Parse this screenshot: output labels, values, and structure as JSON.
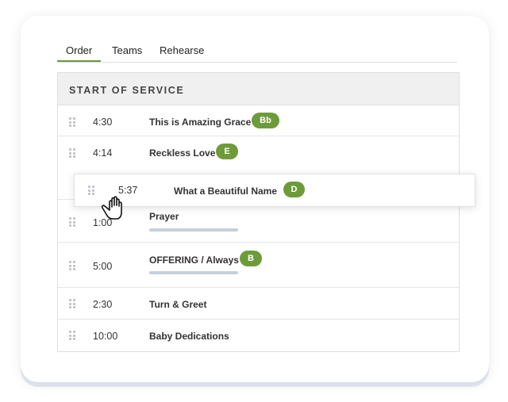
{
  "tabs": [
    {
      "label": "Order",
      "active": true
    },
    {
      "label": "Teams",
      "active": false
    },
    {
      "label": "Rehearse",
      "active": false
    }
  ],
  "section": {
    "title": "START OF SERVICE"
  },
  "items": [
    {
      "time": "4:30",
      "title": "This is Amazing Grace",
      "key": "Bb"
    },
    {
      "time": "4:14",
      "title": "Reckless Love",
      "key": "E"
    },
    {
      "time": "1:00",
      "title": "Prayer",
      "key": ""
    },
    {
      "time": "5:00",
      "title": "OFFERING / Always",
      "key": "B"
    },
    {
      "time": "2:30",
      "title": "Turn & Greet",
      "key": ""
    },
    {
      "time": "10:00",
      "title": "Baby Dedications",
      "key": ""
    }
  ],
  "dragging": {
    "time": "5:37",
    "title": "What a Beautiful Name",
    "key": "D"
  },
  "colors": {
    "accent": "#6b9a34",
    "key_badge": "#6d9b3a",
    "progress": "#c6d0dc"
  },
  "icons": {
    "grip": "grip-dots-icon",
    "cursor": "grab-hand-icon"
  }
}
